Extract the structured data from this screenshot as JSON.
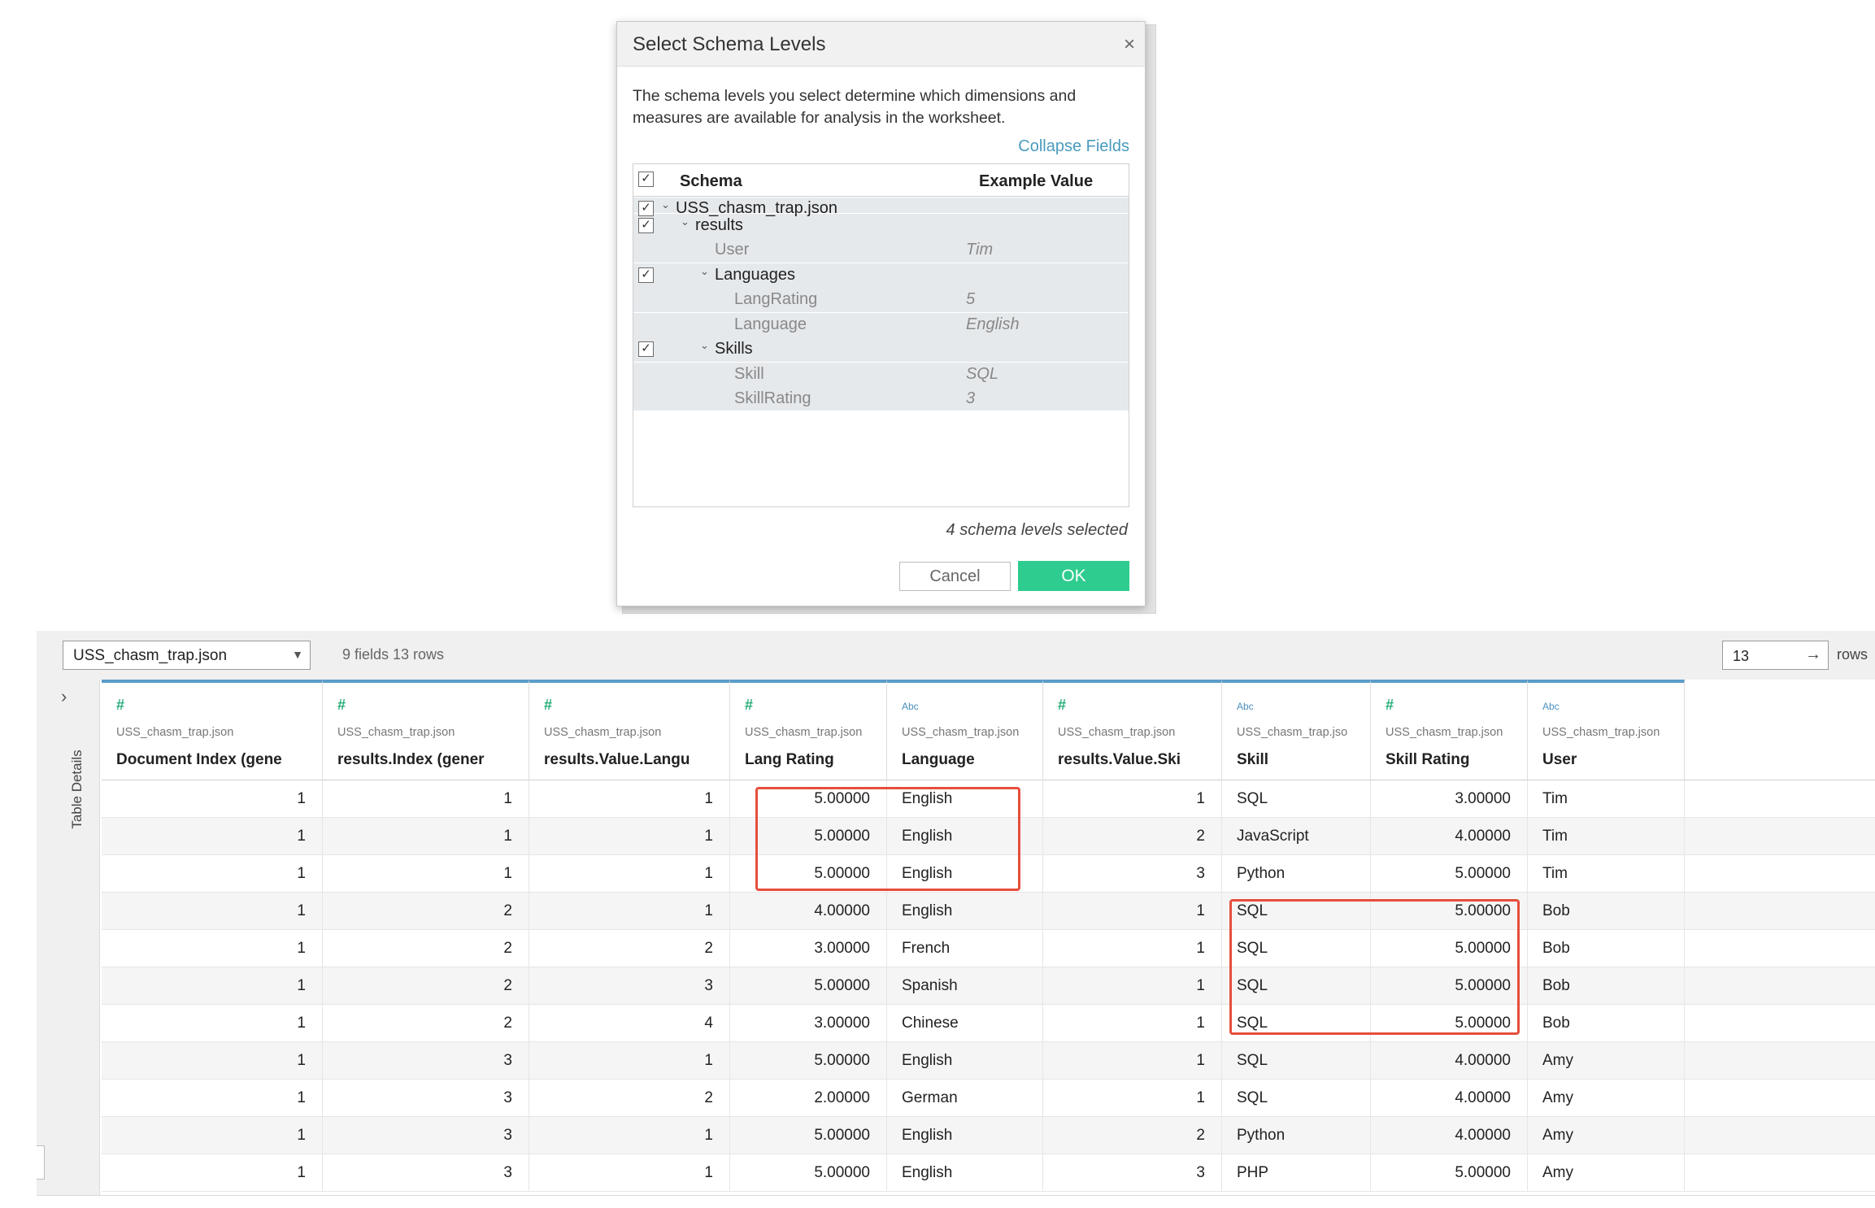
{
  "dialog": {
    "title": "Select Schema Levels",
    "close_glyph": "×",
    "description": "The schema levels you select determine which dimensions and measures are available for analysis in the worksheet.",
    "collapse_link": "Collapse Fields",
    "header_schema": "Schema",
    "header_example": "Example Value",
    "rows": [
      {
        "label": "USS_chasm_trap.json",
        "example": "",
        "kind": "level",
        "checked": true
      },
      {
        "label": "results",
        "example": "",
        "kind": "level",
        "checked": true
      },
      {
        "label": "User",
        "example": "Tim",
        "kind": "field"
      },
      {
        "label": "Languages",
        "example": "",
        "kind": "level",
        "checked": true
      },
      {
        "label": "LangRating",
        "example": "5",
        "kind": "field"
      },
      {
        "label": "Language",
        "example": "English",
        "kind": "field"
      },
      {
        "label": "Skills",
        "example": "",
        "kind": "level",
        "checked": true
      },
      {
        "label": "Skill",
        "example": "SQL",
        "kind": "field"
      },
      {
        "label": "SkillRating",
        "example": "3",
        "kind": "field"
      }
    ],
    "selected_count": "4 schema levels selected",
    "cancel_label": "Cancel",
    "ok_label": "OK"
  },
  "toolbar": {
    "datasource": "USS_chasm_trap.json",
    "fields_rows": "9 fields 13 rows",
    "rows_value": "13",
    "rows_label": "rows"
  },
  "sidebar": {
    "label": "Table Details"
  },
  "table": {
    "columns": [
      {
        "type": "#",
        "source": "USS_chasm_trap.json",
        "name": "Document Index (gene",
        "align": "num"
      },
      {
        "type": "#",
        "source": "USS_chasm_trap.json",
        "name": "results.Index (gener",
        "align": "num"
      },
      {
        "type": "#",
        "source": "USS_chasm_trap.json",
        "name": "results.Value.Langu",
        "align": "num"
      },
      {
        "type": "#",
        "source": "USS_chasm_trap.json",
        "name": "Lang Rating",
        "align": "num"
      },
      {
        "type": "Abc",
        "source": "USS_chasm_trap.json",
        "name": "Language",
        "align": "txt"
      },
      {
        "type": "#",
        "source": "USS_chasm_trap.json",
        "name": "results.Value.Ski",
        "align": "num"
      },
      {
        "type": "Abc",
        "source": "USS_chasm_trap.jso",
        "name": "Skill",
        "align": "txt"
      },
      {
        "type": "#",
        "source": "USS_chasm_trap.json",
        "name": "Skill Rating",
        "align": "num"
      },
      {
        "type": "Abc",
        "source": "USS_chasm_trap.json",
        "name": "User",
        "align": "txt"
      }
    ],
    "rows": [
      [
        "1",
        "1",
        "1",
        "5.00000",
        "English",
        "1",
        "SQL",
        "3.00000",
        "Tim"
      ],
      [
        "1",
        "1",
        "1",
        "5.00000",
        "English",
        "2",
        "JavaScript",
        "4.00000",
        "Tim"
      ],
      [
        "1",
        "1",
        "1",
        "5.00000",
        "English",
        "3",
        "Python",
        "5.00000",
        "Tim"
      ],
      [
        "1",
        "2",
        "1",
        "4.00000",
        "English",
        "1",
        "SQL",
        "5.00000",
        "Bob"
      ],
      [
        "1",
        "2",
        "2",
        "3.00000",
        "French",
        "1",
        "SQL",
        "5.00000",
        "Bob"
      ],
      [
        "1",
        "2",
        "3",
        "5.00000",
        "Spanish",
        "1",
        "SQL",
        "5.00000",
        "Bob"
      ],
      [
        "1",
        "2",
        "4",
        "3.00000",
        "Chinese",
        "1",
        "SQL",
        "5.00000",
        "Bob"
      ],
      [
        "1",
        "3",
        "1",
        "5.00000",
        "English",
        "1",
        "SQL",
        "4.00000",
        "Amy"
      ],
      [
        "1",
        "3",
        "2",
        "2.00000",
        "German",
        "1",
        "SQL",
        "4.00000",
        "Amy"
      ],
      [
        "1",
        "3",
        "1",
        "5.00000",
        "English",
        "2",
        "Python",
        "4.00000",
        "Amy"
      ],
      [
        "1",
        "3",
        "1",
        "5.00000",
        "English",
        "3",
        "PHP",
        "5.00000",
        "Amy"
      ]
    ]
  },
  "colors": {
    "accent_ok": "#2ecc8e",
    "link": "#4a9bbd",
    "header_accent": "#5b9dc9",
    "highlight": "#e64e3c"
  }
}
